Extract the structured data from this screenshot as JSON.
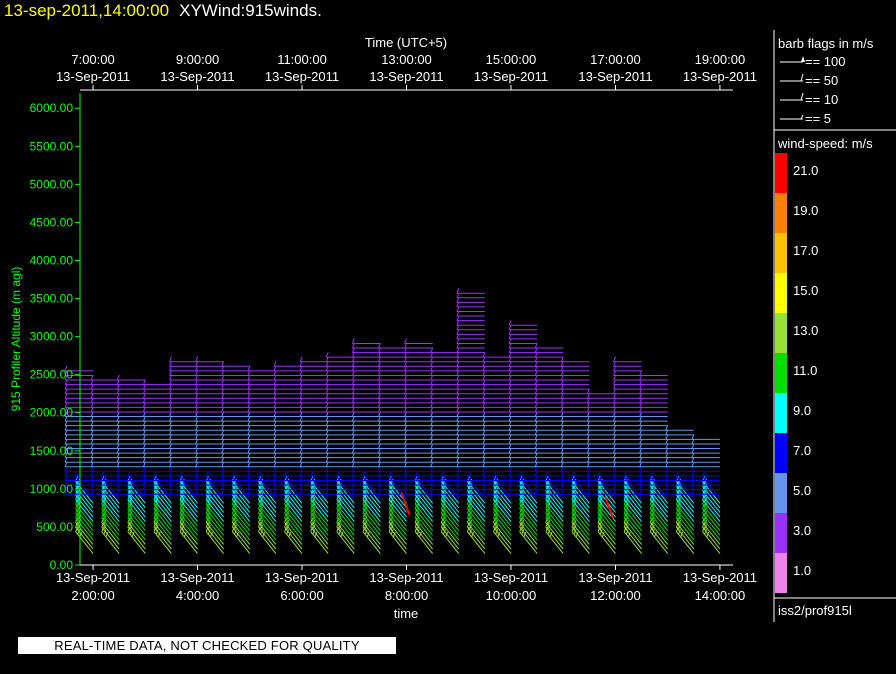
{
  "title": {
    "datetime": "13-sep-2011,14:00:00",
    "name": "XYWind:915winds."
  },
  "legend": {
    "barb_title": "barb flags in m/s",
    "barbs": [
      "== 100",
      "== 50",
      "== 10",
      "== 5"
    ],
    "speed_title": "wind-speed: m/s",
    "speed_labels": [
      "21.0",
      "19.0",
      "17.0",
      "15.0",
      "13.0",
      "11.0",
      "9.0",
      "7.0",
      "5.0",
      "3.0",
      "1.0"
    ],
    "speed_colors": [
      "#ff0000",
      "#ff8000",
      "#ffc000",
      "#ffff00",
      "#99e033",
      "#00e000",
      "#00ffff",
      "#0000ff",
      "#6495ed",
      "#9b30ff",
      "#ee82ee"
    ],
    "source": "iss2/prof915l"
  },
  "qc_banner": "REAL-TIME DATA, NOT CHECKED FOR QUALITY",
  "chart_data": {
    "type": "wind-barb profile (time-height)",
    "ylabel": "915 Profiler Altitude (m agl)",
    "xlabel": "time",
    "top_axis_label": "Time (UTC+5)",
    "ylim": [
      0,
      6200
    ],
    "yticks": [
      "0.00",
      "500.00",
      "1000.00",
      "1500.00",
      "2000.00",
      "2500.00",
      "3000.00",
      "3500.00",
      "4000.00",
      "4500.00",
      "5000.00",
      "5500.00",
      "6000.00"
    ],
    "xlim_hours": [
      1.75,
      14.25
    ],
    "bottom_ticks": [
      {
        "h": 2,
        "date": "13-Sep-2011",
        "time": "2:00:00"
      },
      {
        "h": 4,
        "date": "13-Sep-2011",
        "time": "4:00:00"
      },
      {
        "h": 6,
        "date": "13-Sep-2011",
        "time": "6:00:00"
      },
      {
        "h": 8,
        "date": "13-Sep-2011",
        "time": "8:00:00"
      },
      {
        "h": 10,
        "date": "13-Sep-2011",
        "time": "10:00:00"
      },
      {
        "h": 12,
        "date": "13-Sep-2011",
        "time": "12:00:00"
      },
      {
        "h": 14,
        "date": "13-Sep-2011",
        "time": "14:00:00"
      }
    ],
    "top_ticks": [
      {
        "h": 2,
        "time": "7:00:00",
        "date": "13-Sep-2011"
      },
      {
        "h": 4,
        "time": "9:00:00",
        "date": "13-Sep-2011"
      },
      {
        "h": 6,
        "time": "11:00:00",
        "date": "13-Sep-2011"
      },
      {
        "h": 8,
        "time": "13:00:00",
        "date": "13-Sep-2011"
      },
      {
        "h": 10,
        "time": "15:00:00",
        "date": "13-Sep-2011"
      },
      {
        "h": 12,
        "time": "17:00:00",
        "date": "13-Sep-2011"
      },
      {
        "h": 14,
        "time": "19:00:00",
        "date": "13-Sep-2011"
      }
    ],
    "profile_times_hours": [
      2.0,
      2.5,
      3.0,
      3.5,
      4.0,
      4.5,
      5.0,
      5.5,
      6.0,
      6.5,
      7.0,
      7.5,
      8.0,
      8.5,
      9.0,
      9.5,
      10.0,
      10.5,
      11.0,
      11.5,
      12.0,
      12.5,
      13.0,
      13.5,
      14.0
    ],
    "profile_top_m": [
      2600,
      2450,
      2450,
      2400,
      2700,
      2700,
      2650,
      2600,
      2650,
      2700,
      2750,
      2950,
      2900,
      2950,
      2800,
      3600,
      2750,
      3200,
      2850,
      2700,
      2300,
      2700,
      2500,
      1800,
      1700
    ],
    "gate_spacing_m": 60,
    "wind_direction_deg": 270,
    "speed_profile": [
      {
        "z": 0,
        "speed": 13
      },
      {
        "z": 300,
        "speed": 12
      },
      {
        "z": 700,
        "speed": 9
      },
      {
        "z": 1000,
        "speed": 7
      },
      {
        "z": 1500,
        "speed": 5
      },
      {
        "z": 2000,
        "speed": 4
      },
      {
        "z": 3600,
        "speed": 3
      }
    ],
    "annotations": [
      {
        "h": 7.9,
        "z": 950,
        "speed": 21
      },
      {
        "h": 11.8,
        "z": 900,
        "speed": 21
      }
    ]
  }
}
